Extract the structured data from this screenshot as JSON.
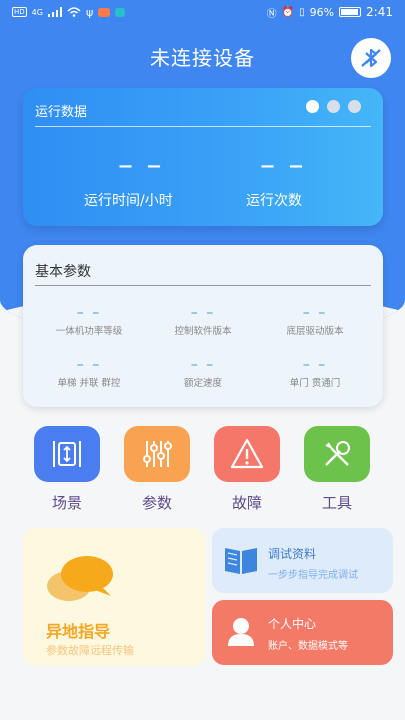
{
  "status_bar": {
    "left_badge": "HD",
    "signal": "4G",
    "time": "2:41",
    "battery": "96%"
  },
  "header": {
    "title": "未连接设备"
  },
  "run_data": {
    "title": "运行数据",
    "hours_value": "– –",
    "hours_label": "运行时间/小时",
    "count_value": "– –",
    "count_label": "运行次数",
    "page_count": 3,
    "active_page": 1
  },
  "basic_params": {
    "title": "基本参数",
    "items": [
      {
        "value": "– –",
        "label": "一体机功率等级"
      },
      {
        "value": "– –",
        "label": "控制软件版本"
      },
      {
        "value": "– –",
        "label": "底层驱动版本"
      },
      {
        "value": "– –",
        "label": "单梯 并联 群控"
      },
      {
        "value": "– –",
        "label": "额定速度"
      },
      {
        "value": "– –",
        "label": "单门 贯通门"
      }
    ]
  },
  "tools": [
    {
      "label": "场景",
      "color": "#4a7ef0"
    },
    {
      "label": "参数",
      "color": "#f9a352"
    },
    {
      "label": "故障",
      "color": "#f4776a"
    },
    {
      "label": "工具",
      "color": "#6cc24a"
    }
  ],
  "cards": {
    "remote": {
      "title": "异地指导",
      "subtitle": "参数故障远程传输"
    },
    "docs": {
      "title": "调试资料",
      "subtitle": "一步步指导完成调试"
    },
    "user": {
      "title": "个人中心",
      "subtitle": "账户、数据模式等"
    }
  },
  "colors": {
    "primary": "#3f86f0",
    "value_text": "#3aa2c8"
  }
}
